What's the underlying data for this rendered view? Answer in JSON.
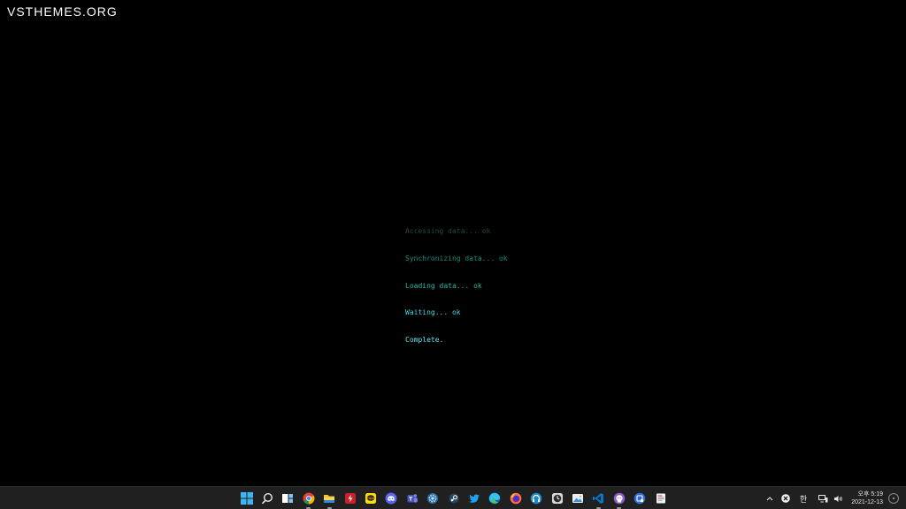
{
  "watermark": "VSTHEMES.ORG",
  "terminal": {
    "lines": [
      {
        "text": "Accessing data... ok",
        "color": "#1c4a48"
      },
      {
        "text": "Synchronizing data... ok",
        "color": "#1f8a7e"
      },
      {
        "text": "Loading data... ok",
        "color": "#2bb7a8"
      },
      {
        "text": "Waiting... ok",
        "color": "#44d6e3"
      },
      {
        "text": "Complete.",
        "color": "#66e4f2"
      }
    ]
  },
  "taskbar": {
    "background": "#202020",
    "icons": [
      {
        "name": "windows-start-icon",
        "label": "Start"
      },
      {
        "name": "search-icon",
        "label": "Search"
      },
      {
        "name": "task-view-icon",
        "label": "Task View"
      },
      {
        "name": "chrome-icon",
        "label": "Google Chrome"
      },
      {
        "name": "file-explorer-icon",
        "label": "File Explorer"
      },
      {
        "name": "flash-app-icon",
        "label": "Flash app"
      },
      {
        "name": "kakaotalk-icon",
        "label": "KakaoTalk"
      },
      {
        "name": "discord-icon",
        "label": "Discord"
      },
      {
        "name": "teams-icon",
        "label": "Microsoft Teams"
      },
      {
        "name": "settings-gear-app-icon",
        "label": "Gear app"
      },
      {
        "name": "steam-icon",
        "label": "Steam"
      },
      {
        "name": "twitter-icon",
        "label": "Twitter"
      },
      {
        "name": "edge-icon",
        "label": "Microsoft Edge"
      },
      {
        "name": "firefox-icon",
        "label": "Firefox"
      },
      {
        "name": "headphones-app-icon",
        "label": "Audio app"
      },
      {
        "name": "clock-app-icon",
        "label": "Clock app"
      },
      {
        "name": "photo-viewer-icon",
        "label": "Photos"
      },
      {
        "name": "vscode-icon",
        "label": "Visual Studio Code"
      },
      {
        "name": "github-icon",
        "label": "GitHub Desktop"
      },
      {
        "name": "cube-app-icon",
        "label": "App"
      },
      {
        "name": "document-app-icon",
        "label": "Document"
      }
    ]
  },
  "tray": {
    "chevron": "^",
    "ime": "한",
    "time_top": "오후 5:19",
    "date": "2021-12-13"
  }
}
